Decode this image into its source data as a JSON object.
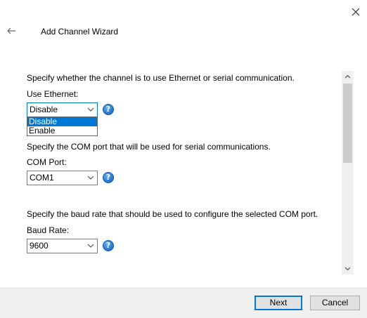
{
  "window": {
    "title": "Add Channel Wizard"
  },
  "sections": [
    {
      "description": "Specify whether the channel is to use Ethernet or serial communication.",
      "label": "Use Ethernet:",
      "selected": "Disable",
      "options": [
        "Disable",
        "Enable"
      ],
      "dropdown_open": true
    },
    {
      "description": "Specify the COM port that will be used for serial communications.",
      "label": "COM Port:",
      "selected": "COM1"
    },
    {
      "description": "Specify the baud rate that should be used to configure the selected COM port.",
      "label": "Baud Rate:",
      "selected": "9600"
    }
  ],
  "help_glyph": "?",
  "buttons": {
    "next": "Next",
    "cancel": "Cancel"
  },
  "colors": {
    "highlight": "#0078d7",
    "help_icon": "#2a7fd4",
    "footer_bg": "#f0f0f0"
  }
}
